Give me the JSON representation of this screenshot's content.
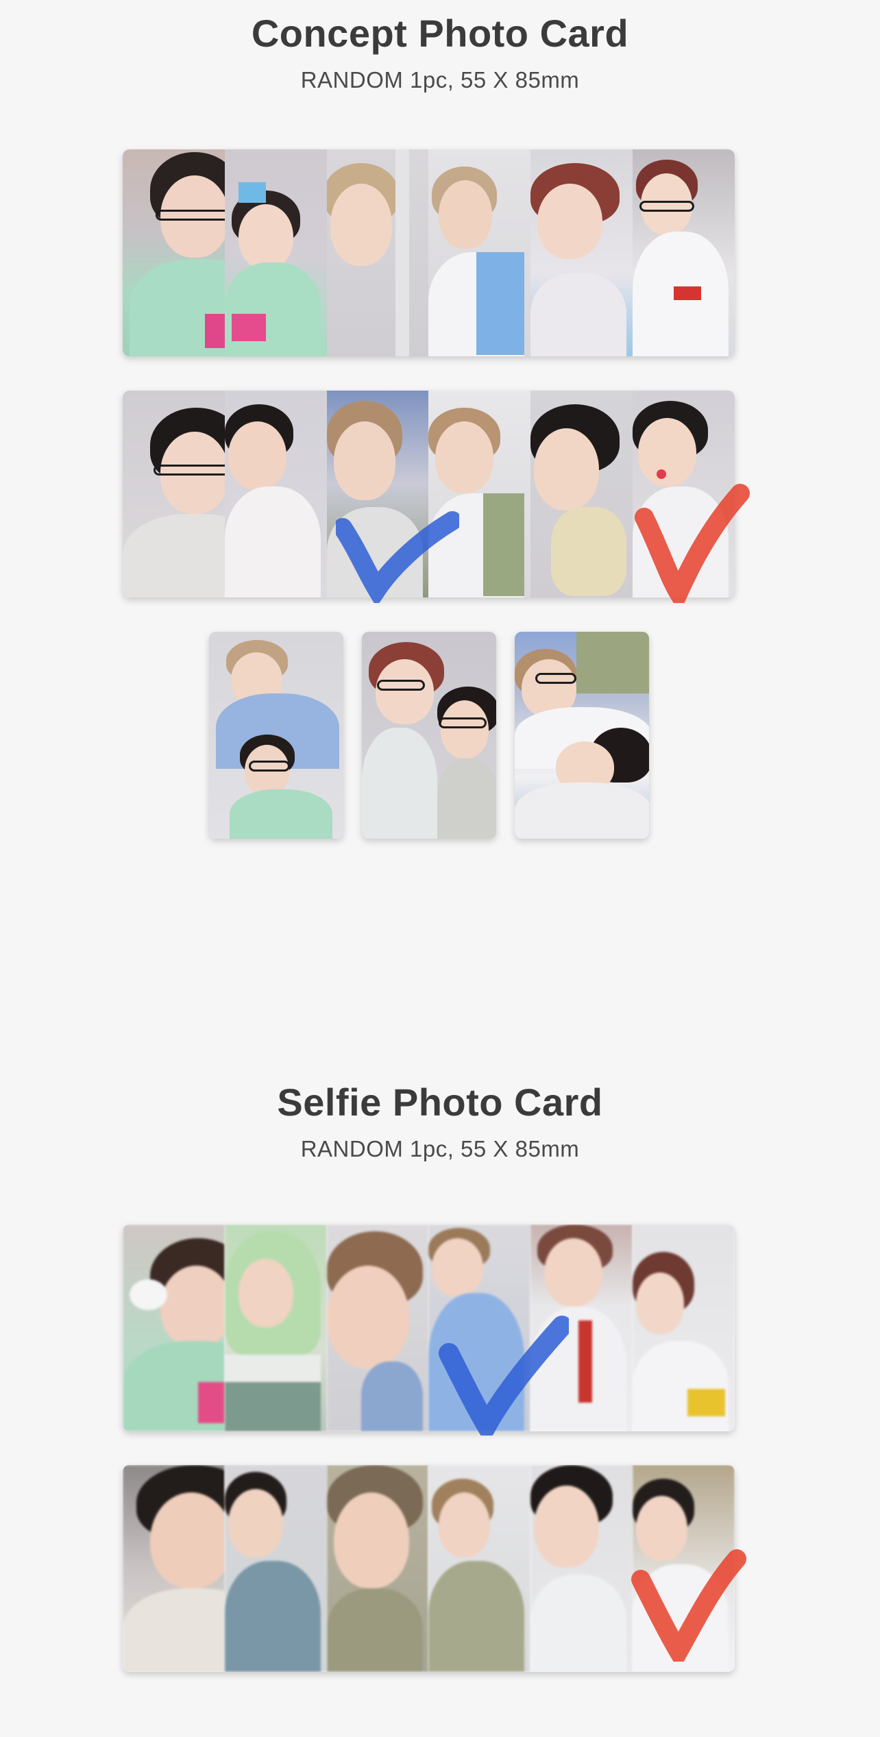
{
  "concept": {
    "title": "Concept Photo Card",
    "subtitle": "RANDOM 1pc, 55 X 85mm"
  },
  "selfie": {
    "title": "Selfie Photo Card",
    "subtitle": "RANDOM 1pc, 55 X 85mm"
  },
  "colors": {
    "background": "#f6f6f6",
    "title_text": "#3b3b3b",
    "check_blue": "#2f5fd6",
    "check_red": "#e8412c"
  }
}
